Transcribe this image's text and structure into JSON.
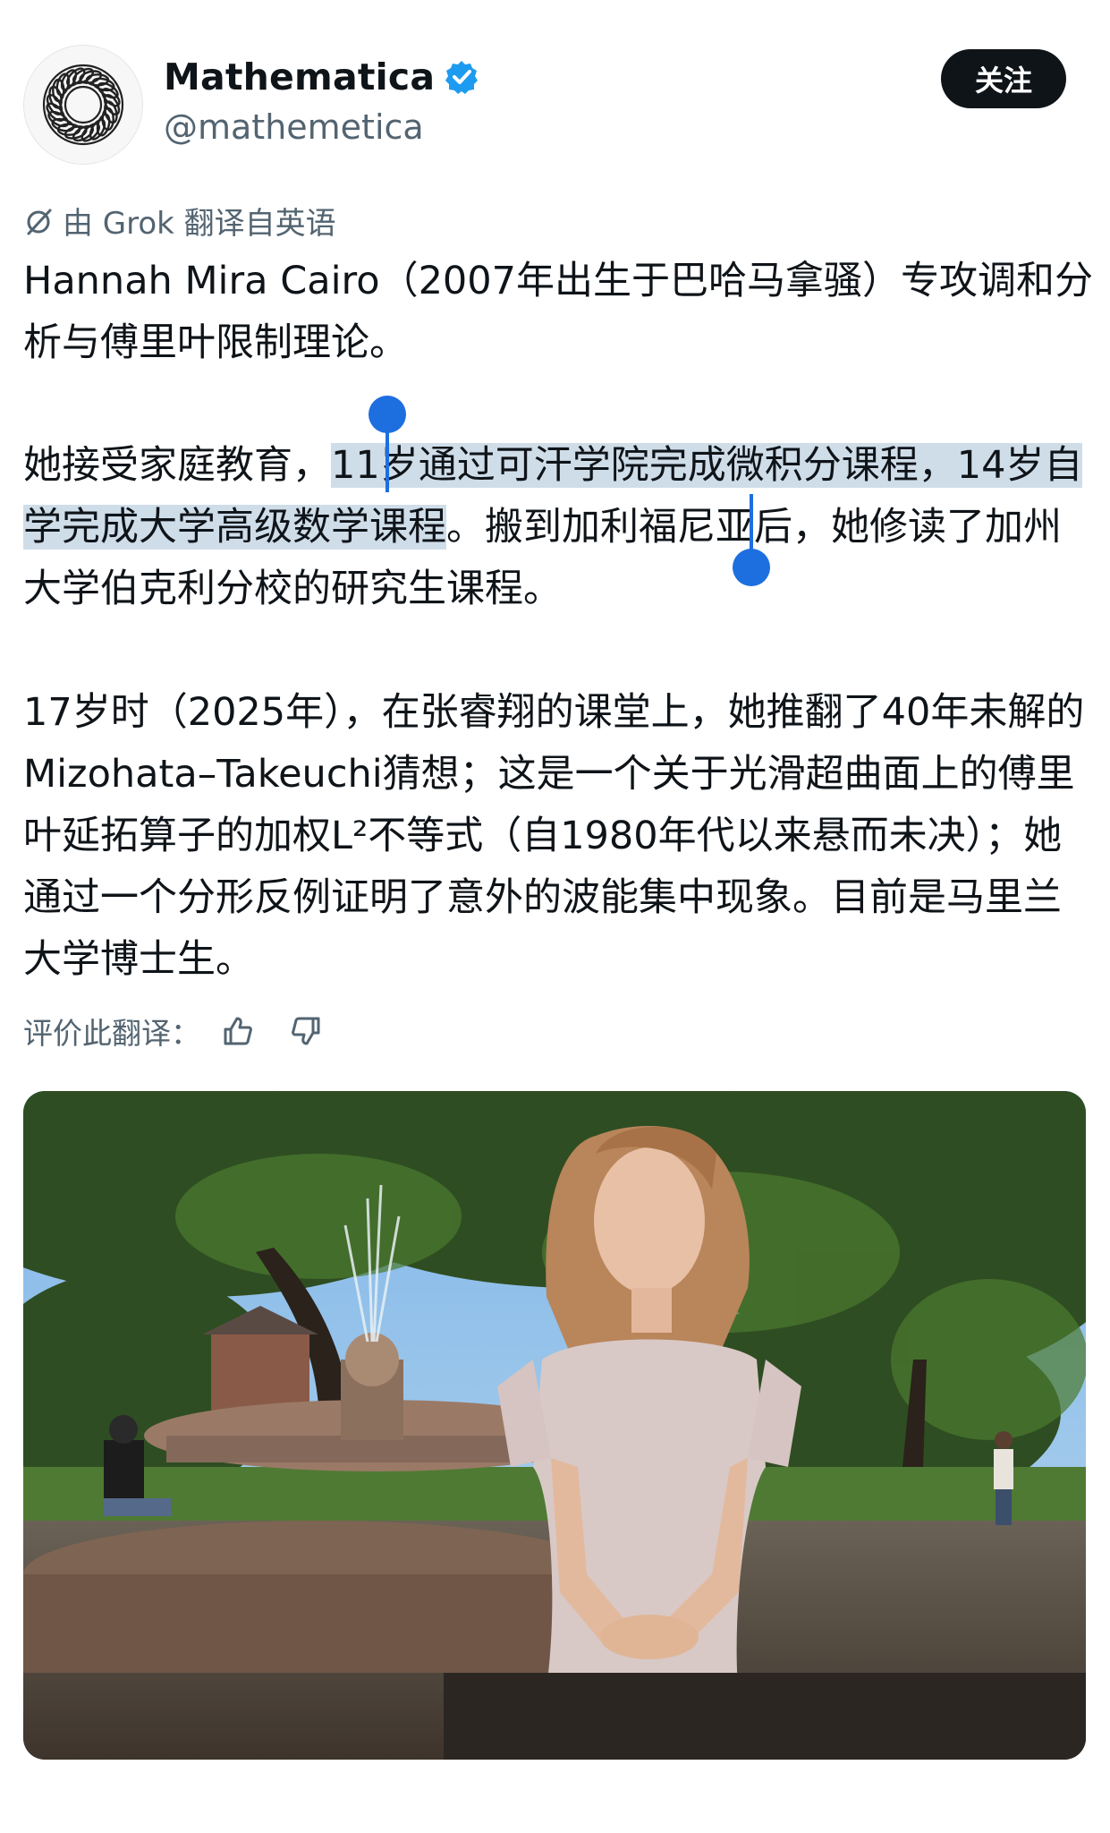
{
  "account": {
    "display_name": "Mathematica",
    "handle": "@mathemetica",
    "avatar_icon": "circular-knot-logo",
    "verified_icon": "verified-badge-icon",
    "verified_color": "#1d9bf0"
  },
  "follow_button": {
    "label": "关注"
  },
  "translation": {
    "icon": "grok-icon",
    "label": "由 Grok 翻译自英语"
  },
  "post": {
    "p1": "Hannah Mira Cairo（2007年出生于巴哈马拿骚）专攻调和分析与傅里叶限制理论。",
    "p2_before": "她接受家庭教育，",
    "p2_highlight": "11岁通过可汗学院完成微积分课程，14岁自学完成大学高级数学课程",
    "p2_after": "。搬到加利福尼亚后，她修读了加州大学伯克利分校的研究生课程。",
    "p3": "17岁时（2025年），在张睿翔的课堂上，她推翻了40年未解的Mizohata–Takeuchi猜想；这是一个关于光滑超曲面上的傅里叶延拓算子的加权L²不等式（自1980年代以来悬而未决）；她通过一个分形反例证明了意外的波能集中现象。目前是马里兰大学博士生。"
  },
  "rating": {
    "label": "评价此翻译：",
    "up_icon": "thumbs-up-icon",
    "down_icon": "thumbs-down-icon"
  },
  "selection_color": "#1d6fe0",
  "highlight_color": "#cfdde9",
  "photo": {
    "alt_subject": "photo-young-woman-by-fountain"
  }
}
